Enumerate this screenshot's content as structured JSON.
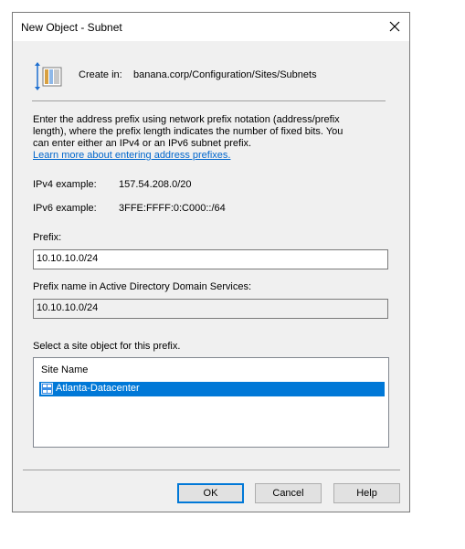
{
  "dialog": {
    "title": "New Object - Subnet",
    "close_glyph": "close-icon"
  },
  "create_in": {
    "label": "Create in:",
    "path": "banana.corp/Configuration/Sites/Subnets",
    "icon": "subnet-container-icon"
  },
  "description": {
    "text": "Enter the address prefix using network prefix notation (address/prefix length), where the prefix length indicates the number of fixed bits. You can enter either an IPv4 or an IPv6 subnet prefix.",
    "link_text": "Learn more about entering address prefixes."
  },
  "examples": {
    "ipv4_label": "IPv4 example:",
    "ipv4_value": "157.54.208.0/20",
    "ipv6_label": "IPv6 example:",
    "ipv6_value": "3FFE:FFFF:0:C000::/64"
  },
  "prefix": {
    "label": "Prefix:",
    "value": "10.10.10.0/24"
  },
  "prefix_name": {
    "label": "Prefix name in Active Directory Domain Services:",
    "value": "10.10.10.0/24"
  },
  "site_select": {
    "label": "Select a site object for this prefix.",
    "column_header": "Site Name",
    "items": [
      {
        "label": "Atlanta-Datacenter",
        "selected": true,
        "icon": "site-icon"
      }
    ]
  },
  "buttons": {
    "ok": "OK",
    "cancel": "Cancel",
    "help": "Help"
  },
  "colors": {
    "accent": "#0078d7",
    "link": "#0066cc"
  }
}
